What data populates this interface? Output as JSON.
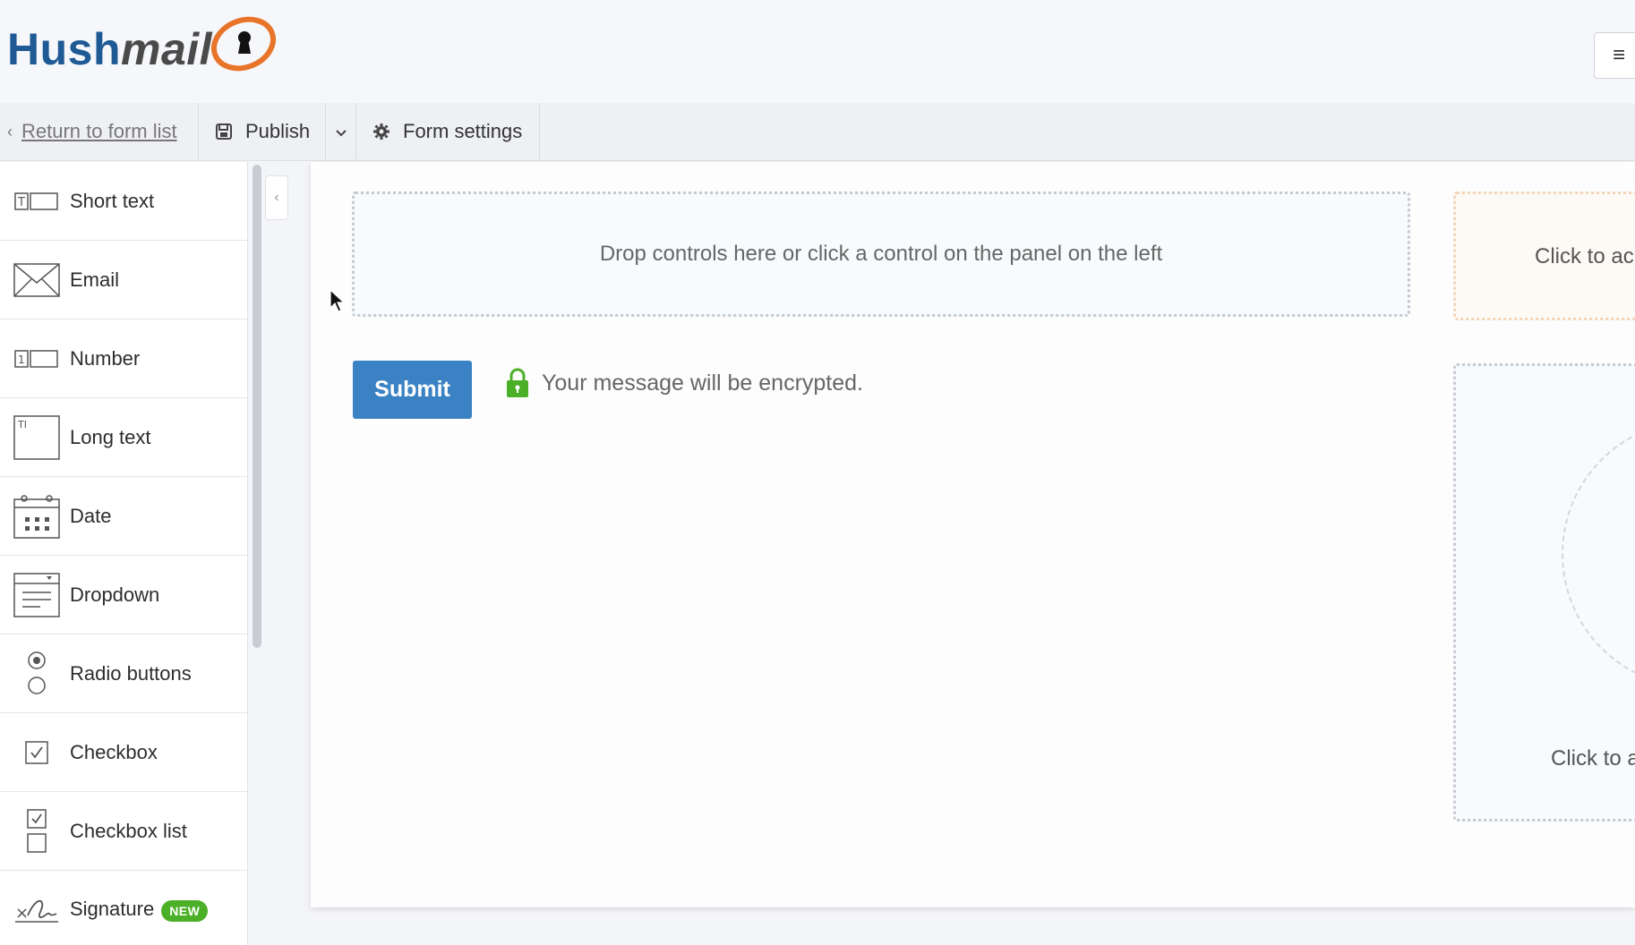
{
  "header": {
    "logo_part1": "Hush",
    "logo_part2": "mail",
    "menu_icon": "hamburger-icon"
  },
  "toolbar": {
    "back_label": "Return to form list",
    "publish_label": "Publish",
    "settings_label": "Form settings"
  },
  "sidebar": {
    "controls": [
      {
        "label": "Short text",
        "icon": "short-text-icon"
      },
      {
        "label": "Email",
        "icon": "email-icon"
      },
      {
        "label": "Number",
        "icon": "number-icon"
      },
      {
        "label": "Long text",
        "icon": "long-text-icon"
      },
      {
        "label": "Date",
        "icon": "calendar-icon"
      },
      {
        "label": "Dropdown",
        "icon": "dropdown-icon"
      },
      {
        "label": "Radio buttons",
        "icon": "radio-icon"
      },
      {
        "label": "Checkbox",
        "icon": "checkbox-icon"
      },
      {
        "label": "Checkbox list",
        "icon": "checkbox-list-icon"
      },
      {
        "label": "Signature",
        "icon": "signature-icon",
        "badge": "NEW"
      }
    ]
  },
  "canvas": {
    "dropzone_text": "Drop controls here or click a control on the panel on the left",
    "submit_label": "Submit",
    "encrypt_text": "Your message will be encrypted.",
    "side_top_text": "Click to ac",
    "side_bottom_text": "Click to a"
  },
  "colors": {
    "brand_blue": "#1f5a95",
    "accent_orange": "#e8742a",
    "submit_blue": "#3b82c4",
    "lock_green": "#4caf28"
  }
}
